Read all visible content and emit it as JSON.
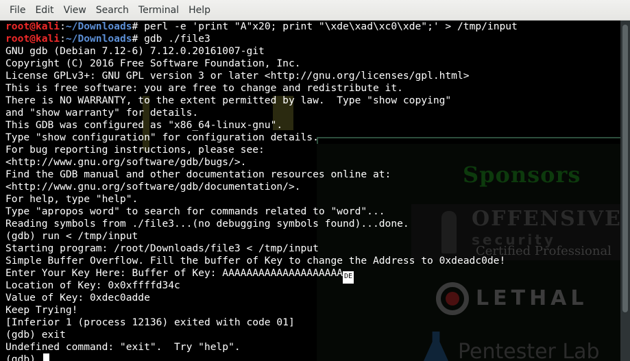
{
  "menu": {
    "items": [
      "File",
      "Edit",
      "View",
      "Search",
      "Terminal",
      "Help"
    ]
  },
  "prompt": {
    "user_host": "root@kali",
    "separator": ":",
    "path": "~/Downloads",
    "symbol": "#"
  },
  "terminal": {
    "commands": [
      " perl -e 'print \"A\"x20; print \"\\xde\\xad\\xc0\\xde\";' > /tmp/input",
      " gdb ./file3"
    ],
    "output": [
      "GNU gdb (Debian 7.12-6) 7.12.0.20161007-git",
      "Copyright (C) 2016 Free Software Foundation, Inc.",
      "License GPLv3+: GNU GPL version 3 or later <http://gnu.org/licenses/gpl.html>",
      "This is free software: you are free to change and redistribute it.",
      "There is NO WARRANTY, to the extent permitted by law.  Type \"show copying\"",
      "and \"show warranty\" for details.",
      "This GDB was configured as \"x86_64-linux-gnu\".",
      "Type \"show configuration\" for configuration details.",
      "For bug reporting instructions, please see:",
      "<http://www.gnu.org/software/gdb/bugs/>.",
      "Find the GDB manual and other documentation resources online at:",
      "<http://www.gnu.org/software/gdb/documentation/>.",
      "For help, type \"help\".",
      "Type \"apropos word\" to search for commands related to \"word\"...",
      "Reading symbols from ./file3...(no debugging symbols found)...done.",
      "(gdb) run < /tmp/input",
      "Starting program: /root/Downloads/file3 < /tmp/input",
      "Simple Buffer Overflow. Fill the buffer of Key to change the Address to 0xdeadc0de!"
    ],
    "key_prompt": "Enter Your Key Here: Buffer of Key: AAAAAAAAAAAAAAAAAAAA",
    "key_glyph": "DE",
    "output_after": [
      "Location of Key: 0x0xffffd34c",
      "Value of Key: 0xdec0adde",
      "Keep Trying!",
      "[Inferior 1 (process 12136) exited with code 01]",
      "(gdb) exit",
      "Undefined command: \"exit\".  Try \"help\"."
    ],
    "final_prompt": "(gdb) "
  },
  "wallpaper": {
    "sponsors_label": "Sponsors",
    "offsec_title": "OFFENSIVE",
    "offsec_sub": "security",
    "offsec_cert": "Certified Professional",
    "lethal_text": "LETHAL",
    "pentester_text": "Pentester Lab"
  },
  "colors": {
    "prompt_user": "#ef2929",
    "prompt_path": "#5c8fd6",
    "terminal_fg": "#ffffff",
    "terminal_bg": "#000000"
  }
}
